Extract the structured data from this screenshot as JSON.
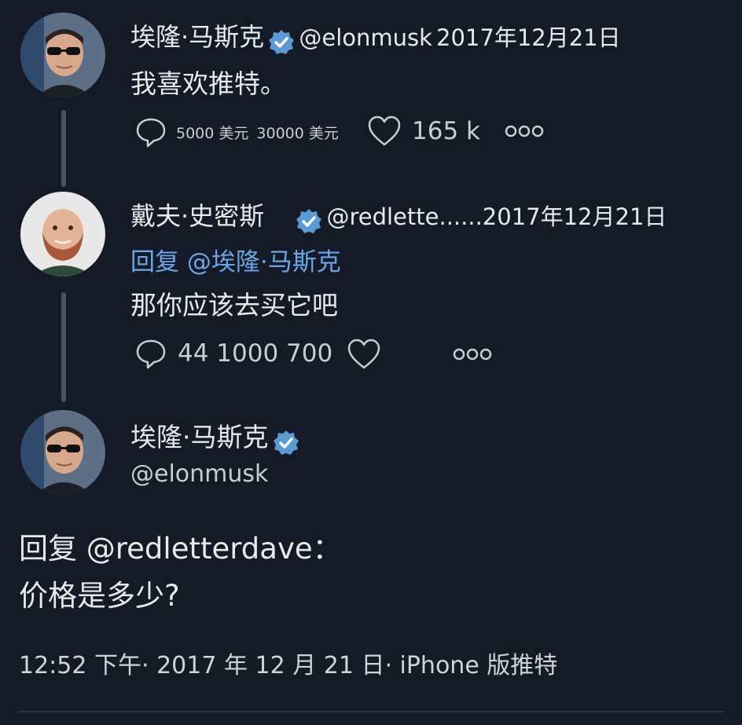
{
  "tweet1": {
    "name": "埃隆·马斯克",
    "handle": "@elonmusk",
    "date": "2017年12月21日",
    "text": "我喜欢推特。",
    "reply_count": "5000 美元",
    "retweet_count": "30000 美元",
    "like_count": "165 k"
  },
  "tweet2": {
    "name": "戴夫·史密斯",
    "handle_date": "@redlette......2017年12月21日",
    "reply_to": "回复 @埃隆·马斯克",
    "text": "那你应该去买它吧",
    "counts": "44 1000 700"
  },
  "main": {
    "name": "埃隆·马斯克",
    "handle": "@elonmusk",
    "reply_to": "回复 @redletterdave：",
    "text": "价格是多少?",
    "footer": "12:52 下午· 2017 年 12 月 21 日· iPhone 版推特"
  },
  "colors": {
    "background": "#151b26",
    "verified_badge": "#5b9bd5",
    "reply_link": "#6ba7e8",
    "thread_line": "#4a5260"
  },
  "icons": {
    "verified": "verified-badge-icon",
    "reply": "reply-bubble-icon",
    "like": "heart-icon",
    "more": "more-dots-icon"
  }
}
